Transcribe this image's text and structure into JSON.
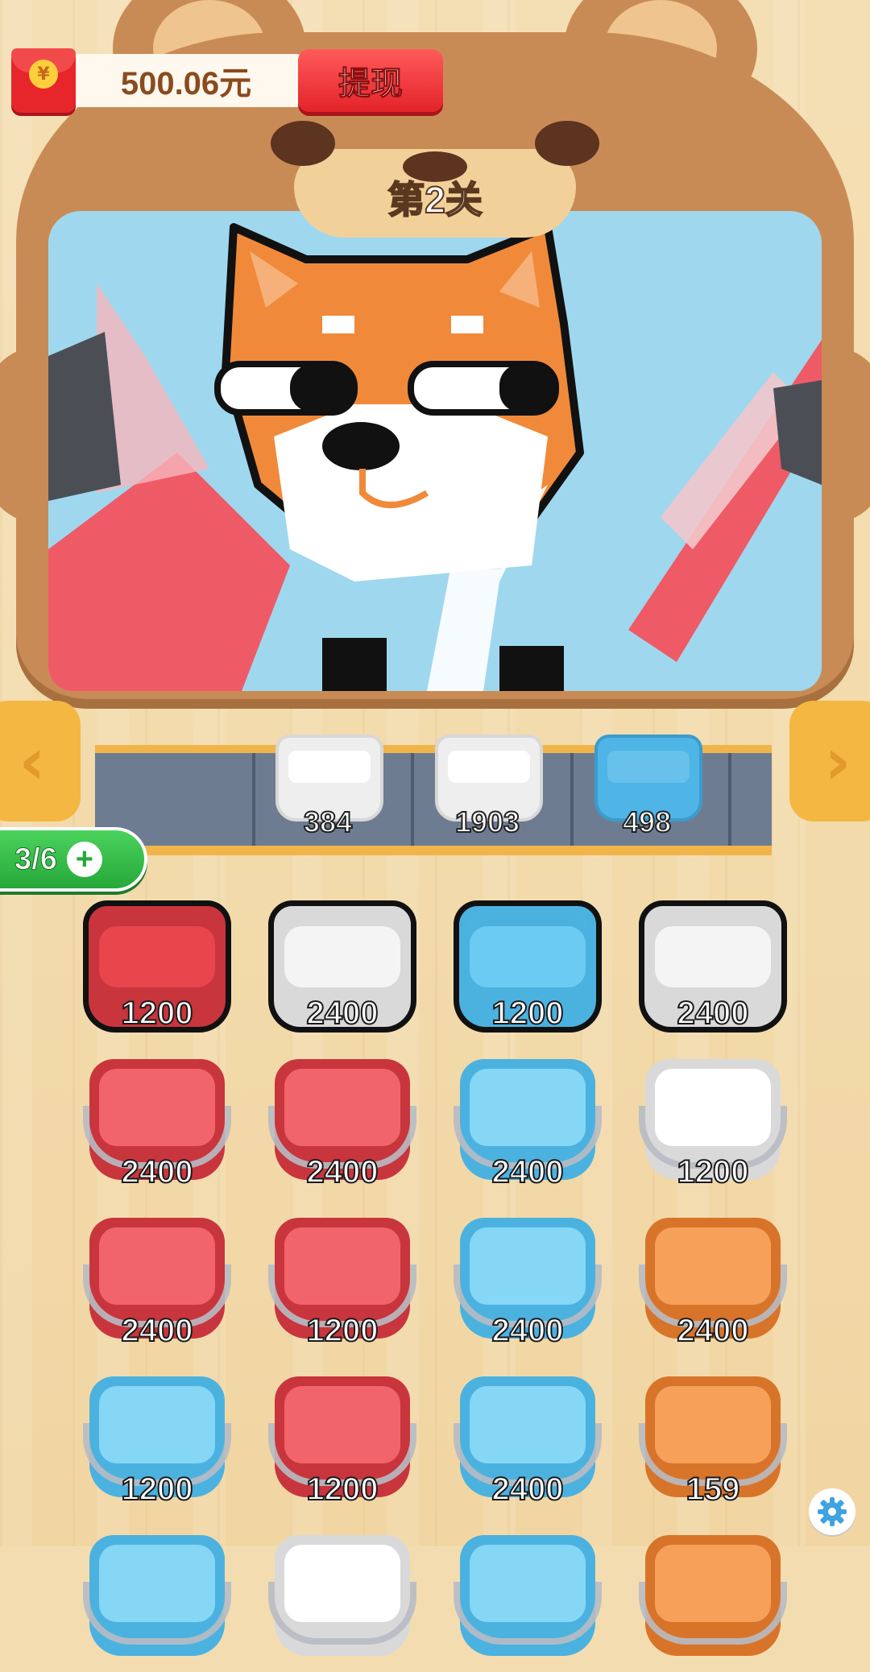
{
  "header": {
    "balance": "500.06元",
    "withdraw_label": "提现",
    "coin_symbol": "¥",
    "level_title": "第2关"
  },
  "colors": {
    "red": "#e8454d",
    "white": "#f4f4f4",
    "blue": "#6ccbf2",
    "orange": "#f08a3a",
    "sky": "#9fd8ee",
    "wood": "#c98b55"
  },
  "icons": {
    "left_arrow": "chevron-left-icon",
    "right_arrow": "chevron-right-icon",
    "settings": "gear-icon",
    "add": "plus-icon",
    "wallet": "red-packet-icon"
  },
  "conveyor": {
    "slots": [
      {
        "color": "white",
        "value": "384"
      },
      {
        "color": "white",
        "value": "1903"
      },
      {
        "color": "blue",
        "value": "498"
      }
    ]
  },
  "extra_slots": {
    "label": "3/6"
  },
  "buckets": [
    {
      "color": "red",
      "value": "1200",
      "open": true
    },
    {
      "color": "white",
      "value": "2400",
      "open": true
    },
    {
      "color": "blue",
      "value": "1200",
      "open": true
    },
    {
      "color": "white",
      "value": "2400",
      "open": true
    },
    {
      "color": "red",
      "value": "2400",
      "open": false
    },
    {
      "color": "red",
      "value": "2400",
      "open": false
    },
    {
      "color": "blue",
      "value": "2400",
      "open": false
    },
    {
      "color": "white",
      "value": "1200",
      "open": false
    },
    {
      "color": "red",
      "value": "2400",
      "open": false
    },
    {
      "color": "red",
      "value": "1200",
      "open": false
    },
    {
      "color": "blue",
      "value": "2400",
      "open": false
    },
    {
      "color": "orange",
      "value": "2400",
      "open": false
    },
    {
      "color": "blue",
      "value": "1200",
      "open": false
    },
    {
      "color": "red",
      "value": "1200",
      "open": false
    },
    {
      "color": "blue",
      "value": "2400",
      "open": false
    },
    {
      "color": "orange",
      "value": "159",
      "open": false
    },
    {
      "color": "blue",
      "value": "",
      "open": false
    },
    {
      "color": "white",
      "value": "",
      "open": false
    },
    {
      "color": "blue",
      "value": "",
      "open": false
    },
    {
      "color": "orange",
      "value": "",
      "open": false
    }
  ]
}
